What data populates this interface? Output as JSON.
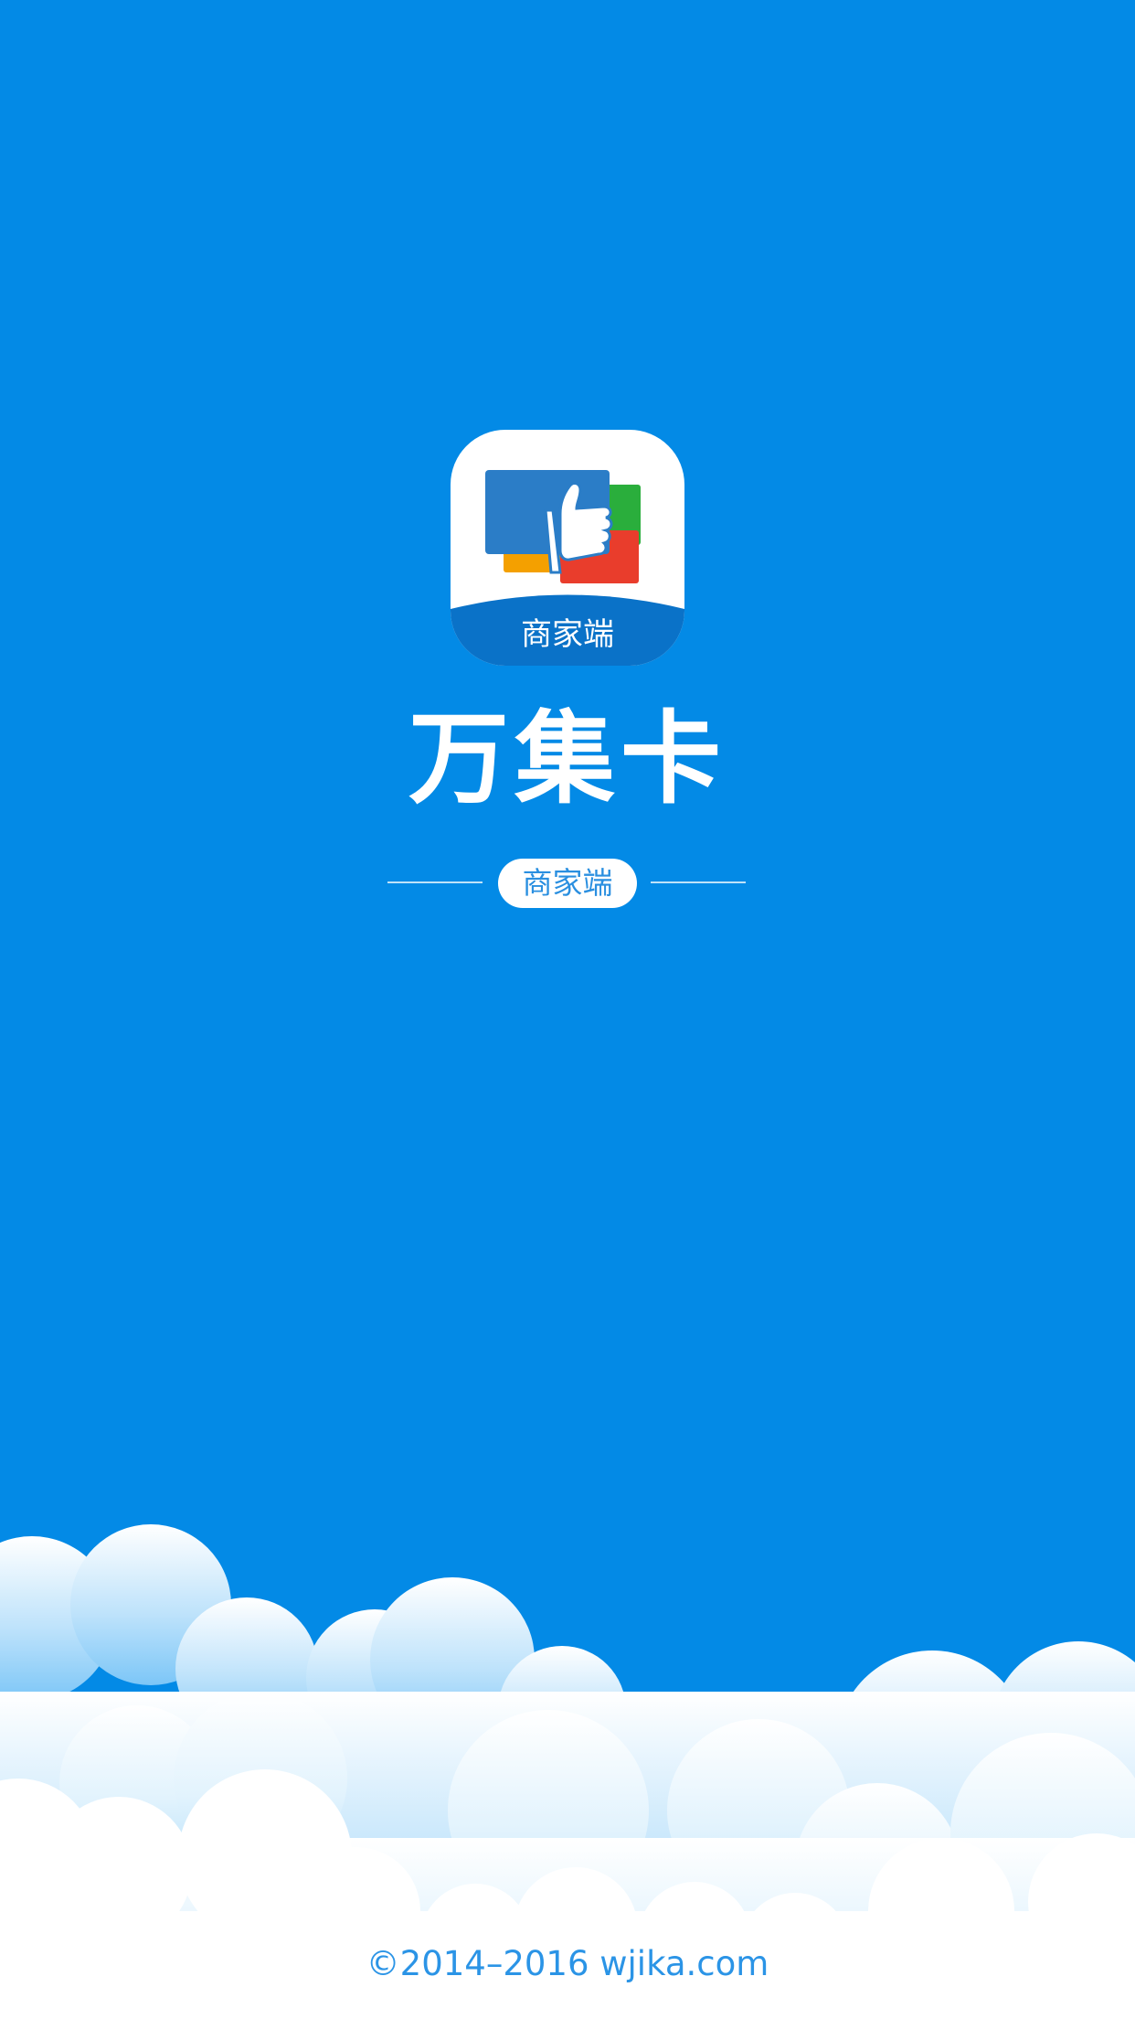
{
  "app": {
    "title": "万集卡",
    "icon_badge_text": "商家端",
    "subtitle_pill": "商家端"
  },
  "footer": {
    "copyright": "©2014–2016 wjika.com"
  },
  "icons": {
    "app_icon": "cards-thumbs-up-icon"
  },
  "colors": {
    "background": "#038ae6",
    "icon_blue": "#2b7dc7",
    "icon_green": "#2aae3c",
    "icon_orange": "#f4a000",
    "icon_red": "#e93d2c",
    "footer_text": "#2b94e6"
  }
}
